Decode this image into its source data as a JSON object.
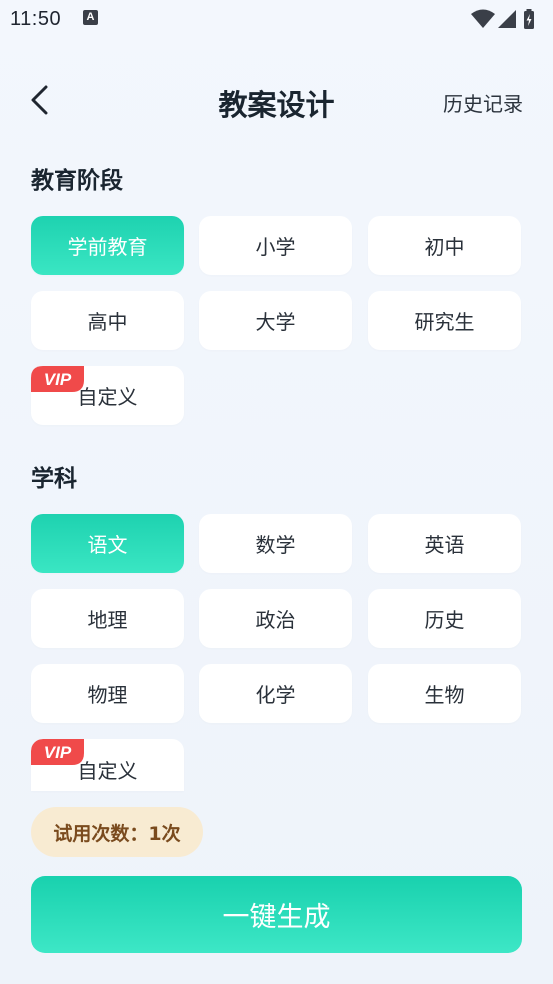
{
  "status_bar": {
    "time": "11:50",
    "notification_icon": "A",
    "icons": [
      "wifi-icon",
      "cellular-icon",
      "battery-icon"
    ]
  },
  "header": {
    "back_icon": "chevron-left-icon",
    "title": "教案设计",
    "history_label": "历史记录"
  },
  "stage": {
    "title": "教育阶段",
    "options": [
      "学前教育",
      "小学",
      "初中",
      "高中",
      "大学",
      "研究生"
    ],
    "selected": "学前教育",
    "custom_label": "自定义",
    "vip_label": "VIP"
  },
  "subject": {
    "title": "学科",
    "options": [
      "语文",
      "数学",
      "英语",
      "地理",
      "政治",
      "历史",
      "物理",
      "化学",
      "生物"
    ],
    "selected": "语文",
    "custom_label": "自定义",
    "vip_label": "VIP"
  },
  "trial": {
    "label": "试用次数：1次"
  },
  "generate_button": {
    "label": "一键生成"
  },
  "colors": {
    "accent": "#22d9b5",
    "vip_red": "#f04a4a",
    "trial_bg": "#f8ebd2",
    "trial_text": "#7a4b1e"
  }
}
